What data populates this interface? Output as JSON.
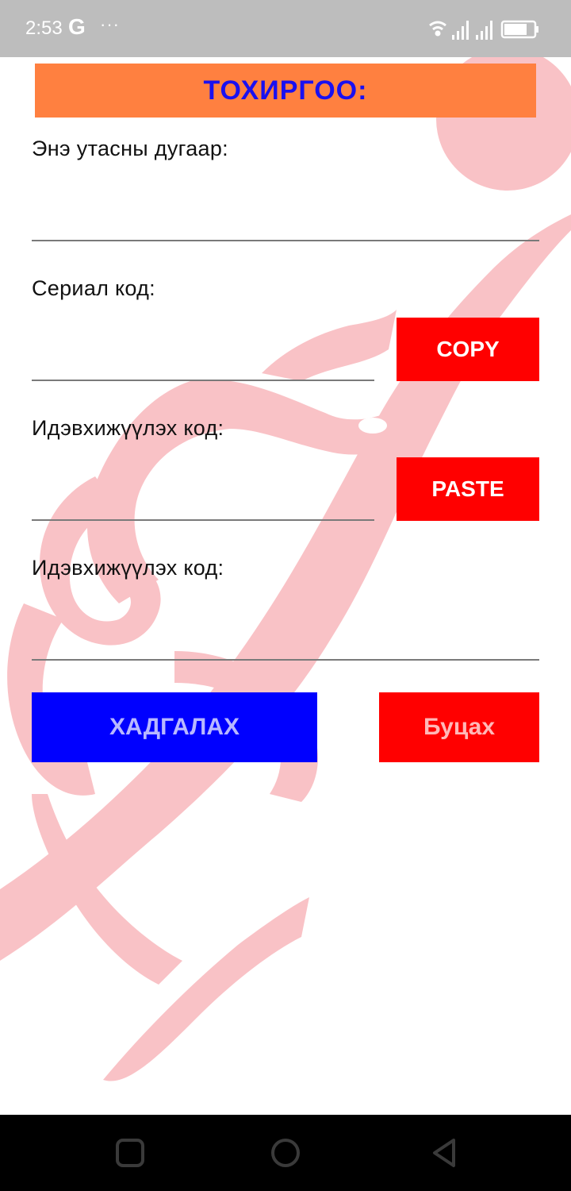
{
  "status_bar": {
    "time": "2:53",
    "google_icon": "G",
    "more_icon": "···",
    "icons": [
      "wifi-icon",
      "signal-icon",
      "signal-icon",
      "battery-icon"
    ]
  },
  "header": {
    "title": "ТОХИРГОО:"
  },
  "form": {
    "phone_label": "Энэ утасны дугаар:",
    "phone_value": "",
    "serial_label": "Сериал код:",
    "serial_value": "",
    "activation_label_1": "Идэвхижүүлэх код:",
    "activation_value_1": "",
    "activation_label_2": "Идэвхижүүлэх код:",
    "activation_value_2": "",
    "copy_label": "COPY",
    "paste_label": "PASTE",
    "save_label": "ХАДГАЛАХ",
    "back_label": "Буцах"
  },
  "colors": {
    "header_bg": "#ff8040",
    "header_text": "#1a10f0",
    "red_button": "#ff0000",
    "save_button": "#0000ff",
    "background_art": "#f9c2c6"
  },
  "nav_bar": {
    "icons": [
      "recent-apps-icon",
      "home-icon",
      "back-icon"
    ]
  }
}
